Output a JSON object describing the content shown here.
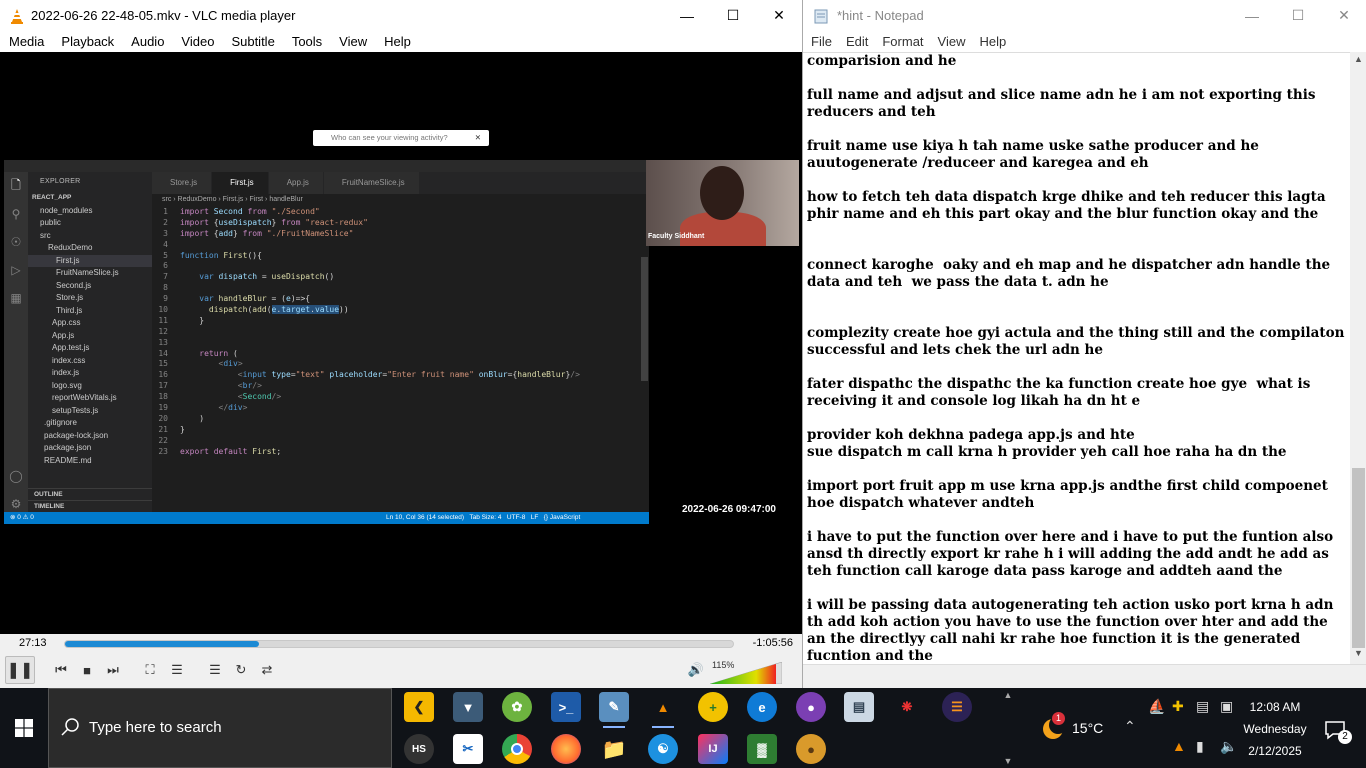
{
  "vlc": {
    "title": "2022-06-26 22-48-05.mkv - VLC media player",
    "menu": [
      "Media",
      "Playback",
      "Audio",
      "Video",
      "Subtitle",
      "Tools",
      "View",
      "Help"
    ],
    "elapsed": "27:13",
    "remaining": "-1:05:56",
    "progress_fraction": 0.29,
    "volume_label": "115%",
    "overlay_prompt": "Who can see your viewing activity?",
    "video_timestamp": "2022-06-26 09:47:00",
    "webcam_name": "Faculty Siddhant",
    "accent_color": "#1c8ad4"
  },
  "vscode": {
    "explorer_header": "EXPLORER",
    "tree": [
      "REACT_APP",
      "node_modules",
      "public",
      "src",
      "ReduxDemo",
      "First.js",
      "FruitNameSlice.js",
      "Second.js",
      "Store.js",
      "Third.js",
      "App.css",
      "App.js",
      "App.test.js",
      "index.css",
      "index.js",
      "logo.svg",
      "reportWebVitals.js",
      "setupTests.js",
      ".gitignore",
      "package-lock.json",
      "package.json",
      "README.md"
    ],
    "outline": "OUTLINE",
    "timeline": "TIMELINE",
    "tabs": [
      "Store.js",
      "First.js",
      "App.js",
      "FruitNameSlice.js"
    ],
    "breadcrumb": "src › ReduxDemo › First.js › First › handleBlur",
    "status_left": "⊗ 0 ⚠ 0",
    "status_right": "Ln 10, Col 36 (14 selected)   Tab Size: 4   UTF-8   LF   {} JavaScript"
  },
  "notepad": {
    "title": "*hint - Notepad",
    "menu": [
      "File",
      "Edit",
      "Format",
      "View",
      "Help"
    ],
    "lines": [
      "comparision and he",
      "",
      "full name and adjsut and slice name adn he i am not exporting this",
      "reducers and teh",
      "",
      "fruit name use kiya h tah name uske sathe producer and he",
      "auutogenerate /reduceer and karegea and eh",
      "",
      "how to fetch teh data dispatch krge dhike and teh reducer this lagta",
      "phir name and eh this part okay and the blur function okay and the",
      "",
      "",
      "connect karoghe  oaky and eh map and he dispatcher adn handle the",
      "data and teh  we pass the data t. adn he",
      "",
      "",
      "complezity create hoe gyi actula and the thing still and the compilaton",
      "successful and lets chek the url adn he",
      "",
      "fater dispathc the dispathc the ka function create hoe gye  what is",
      "receiving it and console log likah ha dn ht e",
      "",
      "provider koh dekhna padega app.js and hte",
      "sue dispatch m call krna h provider yeh call hoe raha ha dn the",
      "",
      "import port fruit app m use krna app.js andthe first child compoenet",
      "hoe dispatch whatever andteh",
      "",
      "i have to put the function over here and i have to put the funtion also",
      "ansd th directly export kr rahe h i will adding the add andt he add as",
      "teh function call karoge data pass karoge and addteh aand the",
      "",
      "i will be passing data autogenerating teh action usko port krna h adn",
      "th add koh action you have to use the function over hter and add the",
      "an the directlyy call nahi kr rahe hoe function it is the generated",
      "fucntion and the"
    ]
  },
  "taskbar": {
    "search_placeholder": "Type here to search",
    "weather_temp": "15°C",
    "weather_badge": "1",
    "time": "12:08 AM",
    "day": "Wednesday",
    "date": "2/12/2025",
    "notification_count": "2"
  }
}
